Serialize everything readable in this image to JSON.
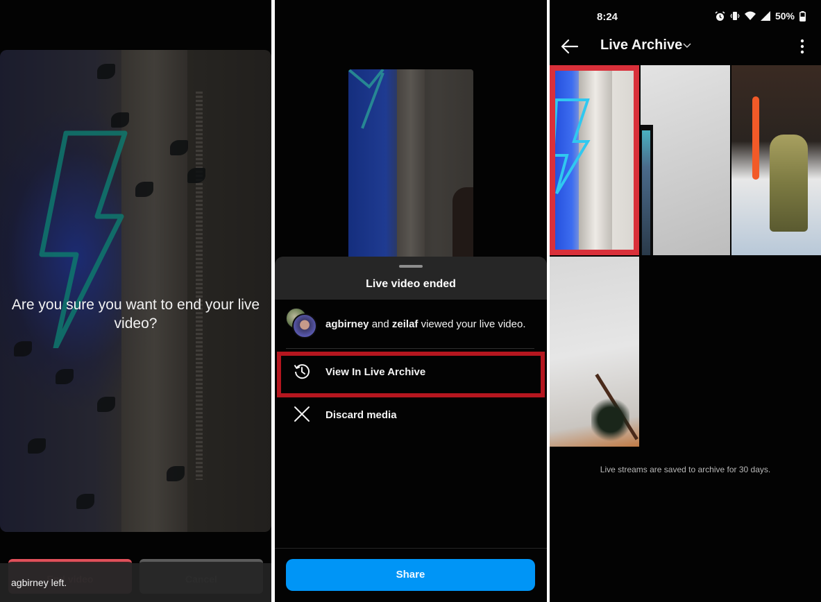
{
  "panel1": {
    "question": "Are you sure you want to end your live video?",
    "end_button_label": "End video",
    "cancel_button_label": "Cancel",
    "toast": "agbirney left."
  },
  "panel2": {
    "sheet_title": "Live video ended",
    "viewers": {
      "user1": "agbirney",
      "conjunction": " and ",
      "user2": "zeilaf",
      "suffix": " viewed your live video."
    },
    "menu": [
      {
        "label": "View In Live Archive",
        "icon": "history-clock-icon",
        "highlighted": true
      },
      {
        "label": "Discard media",
        "icon": "close-icon",
        "highlighted": false
      }
    ],
    "share_label": "Share",
    "colors": {
      "accent": "#0095f6",
      "highlight": "#b5161f"
    }
  },
  "panel3": {
    "status": {
      "time": "8:24",
      "battery": "50%",
      "icons": [
        "alarm-icon",
        "vibrate-icon",
        "wifi-icon",
        "signal-icon",
        "battery-icon"
      ]
    },
    "title": "Live Archive",
    "archive_count": 4,
    "note": "Live streams are saved to archive for 30 days.",
    "selected_tile": 1,
    "colors": {
      "selection": "#d9303a"
    }
  }
}
